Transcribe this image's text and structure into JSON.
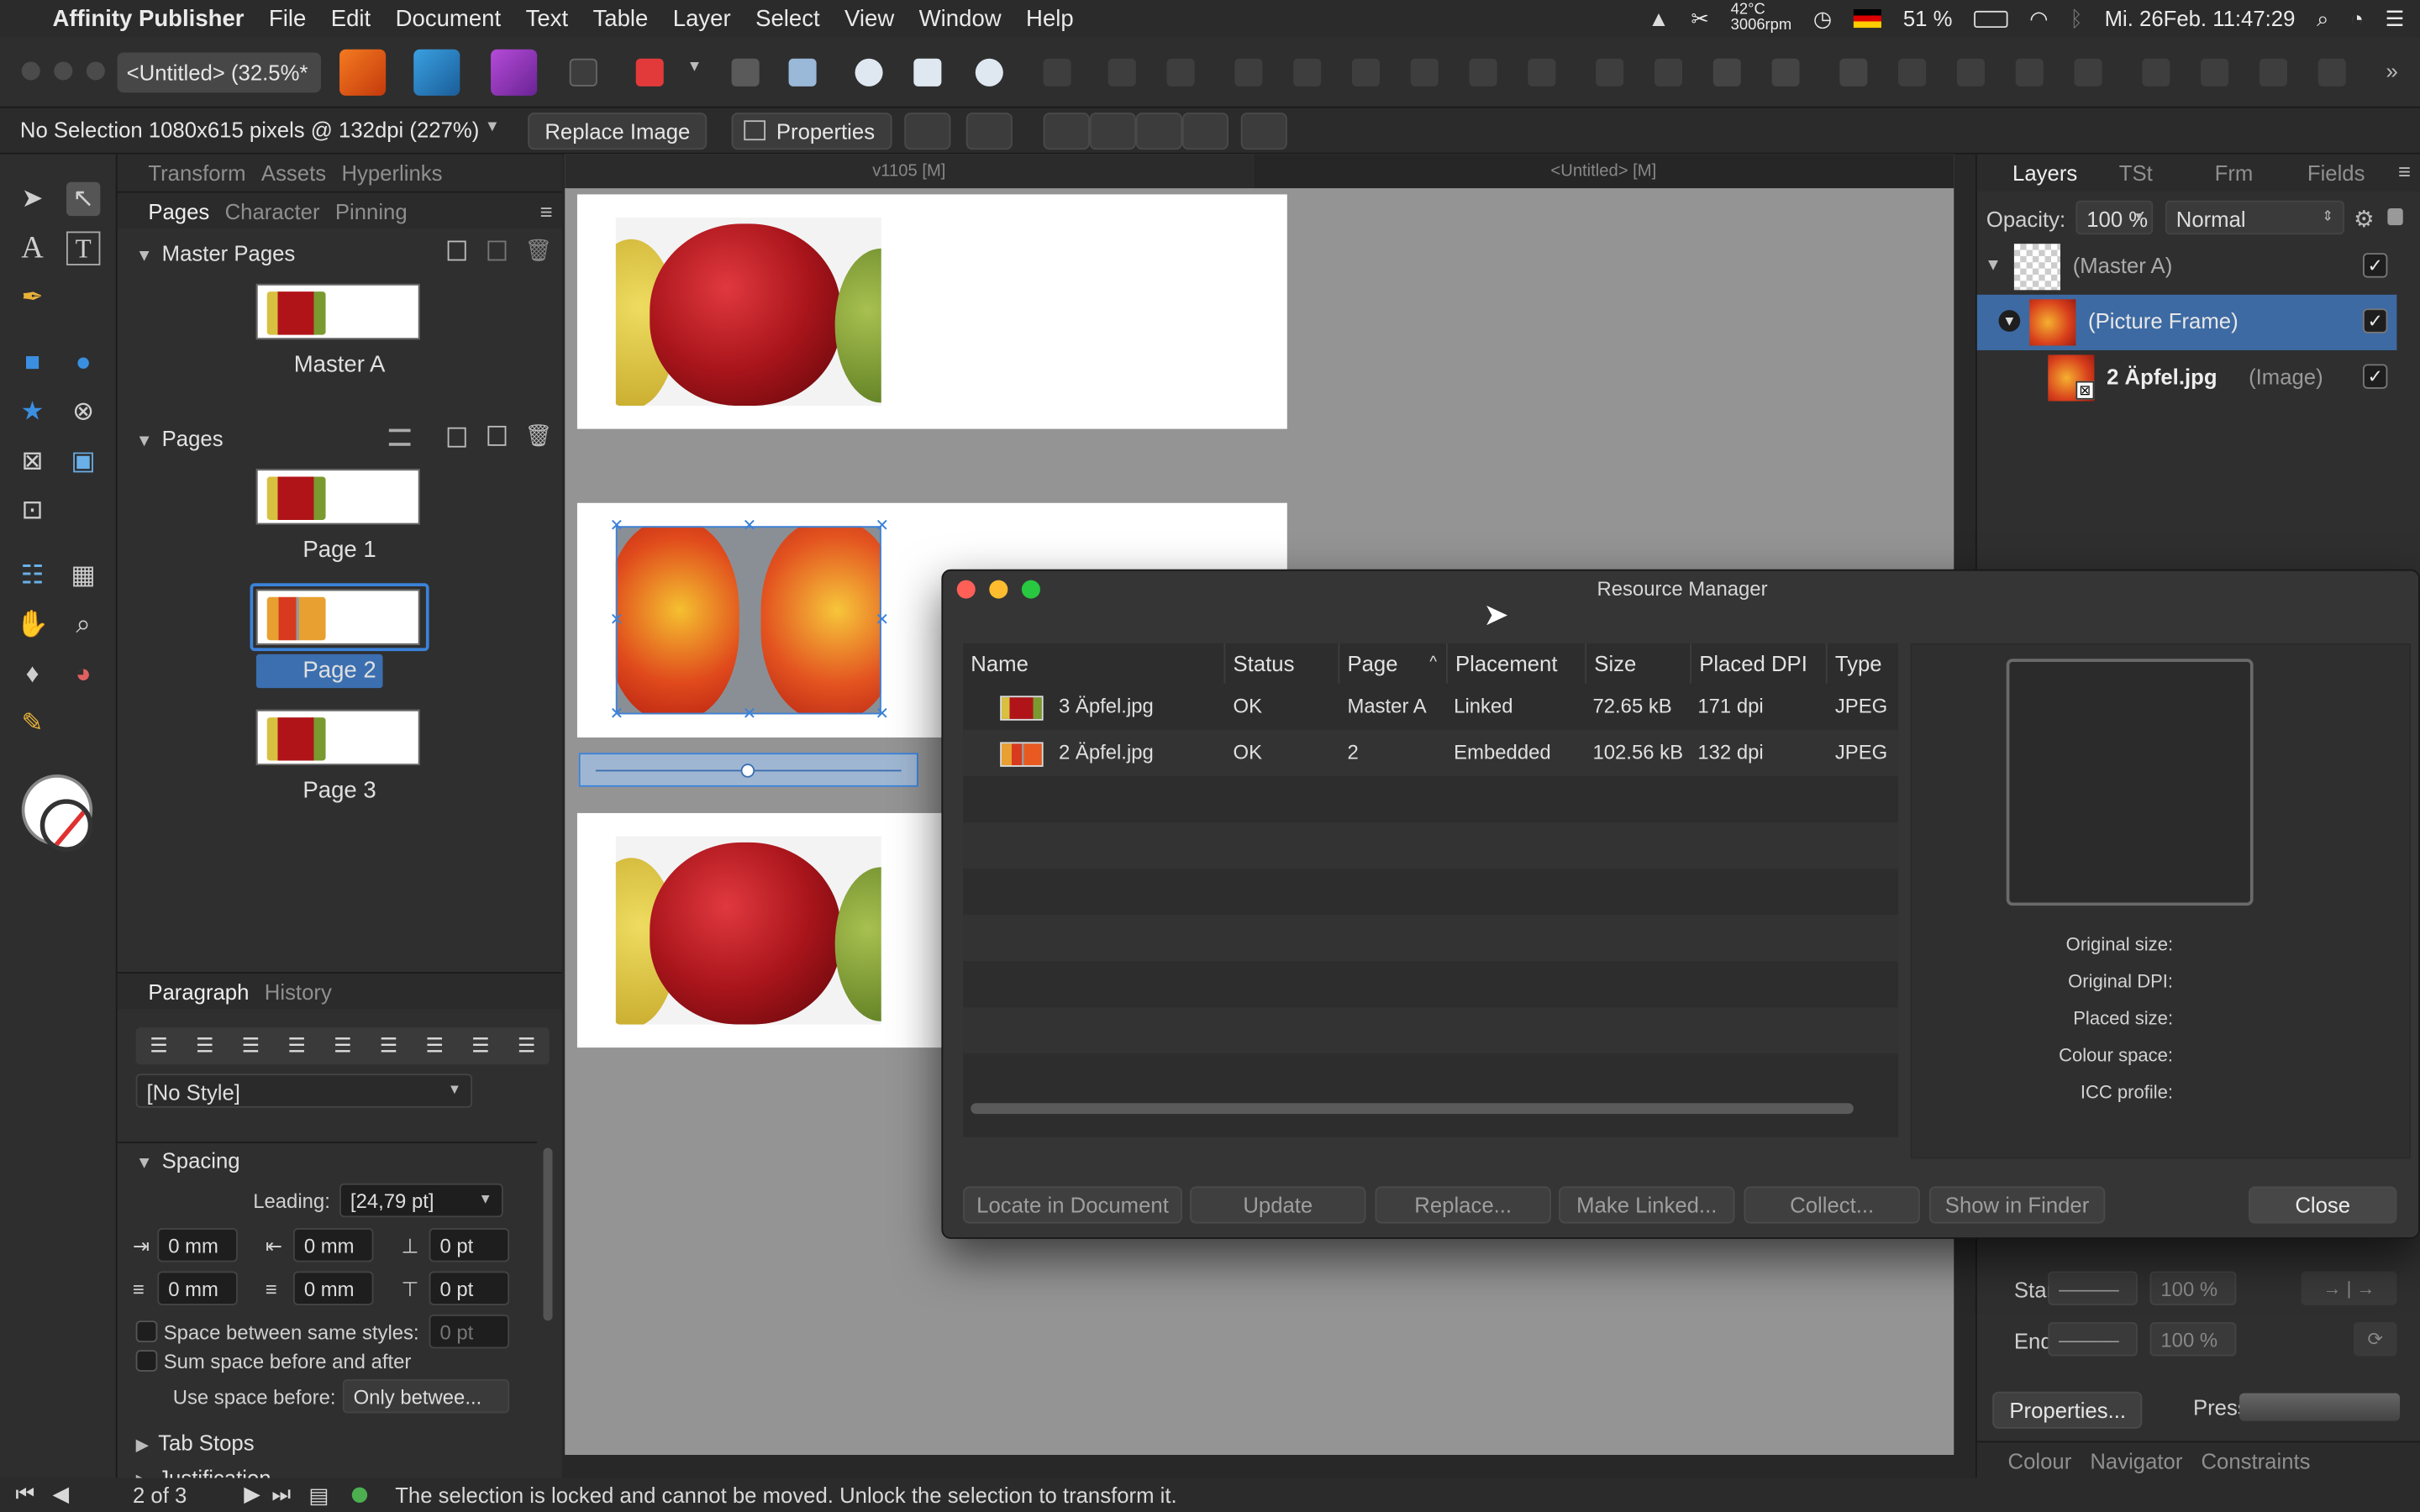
{
  "menubar": {
    "app_name": "Affinity Publisher",
    "items": [
      "File",
      "Edit",
      "Document",
      "Text",
      "Table",
      "Layer",
      "Select",
      "View",
      "Window",
      "Help"
    ],
    "cpu_temp": "42°C",
    "fan_speed": "3006rpm",
    "battery": "51 %",
    "clock": "Mi. 26Feb.  11:47:29"
  },
  "toolbar": {
    "doc_tab": "<Untitled> (32.5%*"
  },
  "context_bar": {
    "selection_info": "No Selection  1080x615 pixels @ 132dpi (227%)",
    "replace_image_label": "Replace Image",
    "properties_label": "Properties"
  },
  "left_panel": {
    "top_tabs": [
      "Transform",
      "Assets",
      "Hyperlinks"
    ],
    "pages_tabs": [
      "Pages",
      "Character",
      "Pinning"
    ],
    "master_pages_title": "Master Pages",
    "master_label": "Master A",
    "pages_title": "Pages",
    "pages": [
      "Page 1",
      "Page 2",
      "Page 3"
    ],
    "para_tabs": [
      "Paragraph",
      "History"
    ],
    "style_value": "[No Style]",
    "spacing_title": "Spacing",
    "leading_label": "Leading:",
    "leading_value": "[24,79 pt]",
    "mm1": "0 mm",
    "mm2": "0 mm",
    "pt1": "0 pt",
    "mm3": "0 mm",
    "mm4": "0 mm",
    "pt2": "0 pt",
    "same_styles_label": "Space between same styles:",
    "same_styles_value": "0 pt",
    "sum_space_label": "Sum space before and after",
    "use_space_label": "Use space before:",
    "use_space_value": "Only betwee...",
    "tab_stops_label": "Tab Stops",
    "justification_label": "Justification"
  },
  "canvas": {
    "ruler_left": "v1105  [M]",
    "ruler_right": "<Untitled>  [M]"
  },
  "right_panel": {
    "tabs": [
      "Layers",
      "TSt",
      "Frm",
      "Fields"
    ],
    "opacity_label": "Opacity:",
    "opacity_value": "100 %",
    "blend_value": "Normal",
    "layers": [
      {
        "name": "(Master A)"
      },
      {
        "name": "(Picture Frame)"
      },
      {
        "name": "2 Äpfel.jpg",
        "suffix": "(Image)"
      }
    ],
    "start_label": "Start:",
    "end_label": "End:",
    "start_pct": "100 %",
    "end_pct": "100 %",
    "properties_btn": "Properties...",
    "pressure_label": "Pressure:",
    "bottom_tabs": [
      "Colour",
      "Navigator",
      "Constraints"
    ]
  },
  "dialog": {
    "title": "Resource Manager",
    "columns": [
      "Name",
      "Status",
      "Page",
      "Placement",
      "Size",
      "Placed DPI",
      "Type"
    ],
    "rows": [
      {
        "name": "3 Äpfel.jpg",
        "status": "OK",
        "page": "Master A",
        "placement": "Linked",
        "size": "72.65 kB",
        "dpi": "171 dpi",
        "type": "JPEG"
      },
      {
        "name": "2 Äpfel.jpg",
        "status": "OK",
        "page": "2",
        "placement": "Embedded",
        "size": "102.56 kB",
        "dpi": "132 dpi",
        "type": "JPEG"
      }
    ],
    "info_labels": [
      "Original size:",
      "Original DPI:",
      "Placed size:",
      "Colour space:",
      "ICC profile:"
    ],
    "buttons": {
      "locate": "Locate in Document",
      "update": "Update",
      "replace": "Replace...",
      "make_linked": "Make Linked...",
      "collect": "Collect...",
      "show_finder": "Show in Finder",
      "close": "Close"
    }
  },
  "status": {
    "page_counter": "2 of 3",
    "message": "The selection is locked and cannot be moved. Unlock the selection to transform it."
  }
}
